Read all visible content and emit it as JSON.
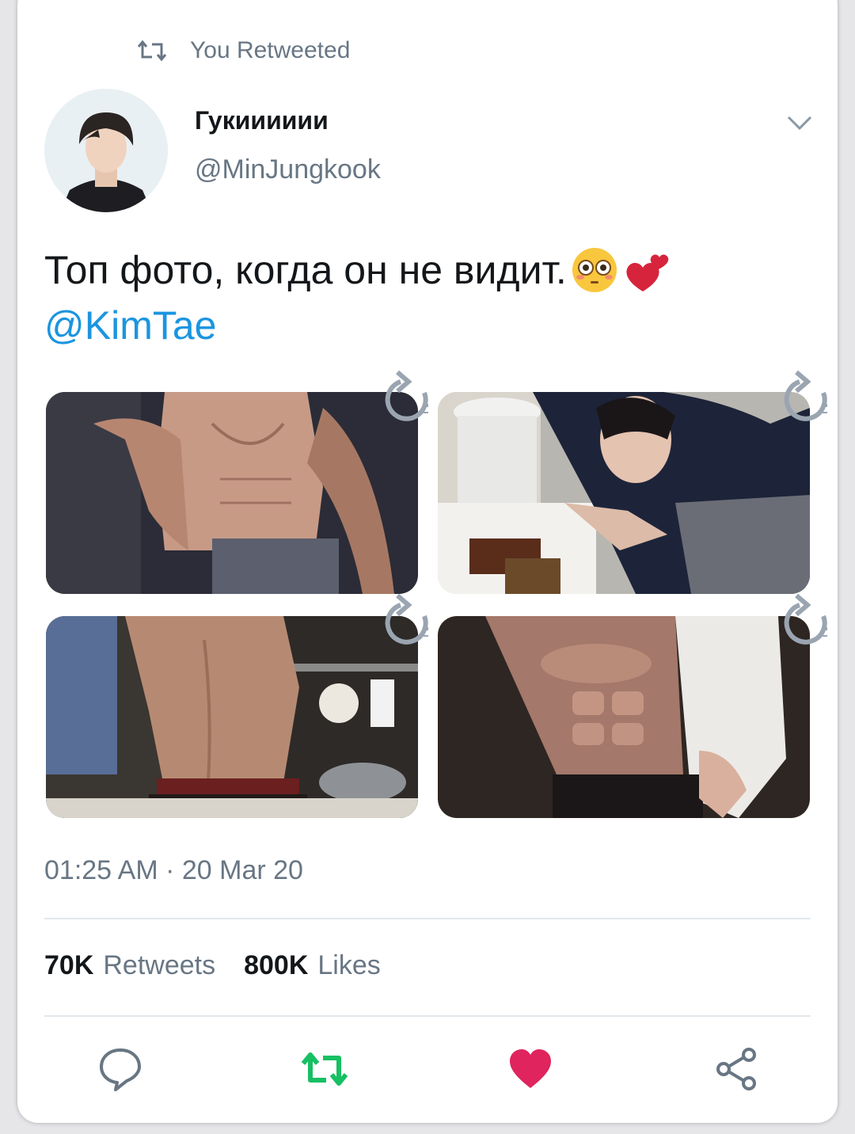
{
  "retweet_context": {
    "label": "You Retweeted"
  },
  "author": {
    "display_name": "Гукииииии",
    "handle": "@MinJungkook"
  },
  "tweet": {
    "text": "Топ фото, когда он не видит.",
    "emojis": [
      "flushed-face",
      "two-hearts"
    ],
    "mention": "@KimTae"
  },
  "media": [
    {
      "name": "photo-1",
      "description_icon": "rotate-icon"
    },
    {
      "name": "photo-2",
      "description_icon": "rotate-icon"
    },
    {
      "name": "photo-3",
      "description_icon": "rotate-icon"
    },
    {
      "name": "photo-4",
      "description_icon": "rotate-icon"
    }
  ],
  "timestamp": "01:25 AM · 20 Mar 20",
  "stats": {
    "retweets": {
      "count": "70K",
      "label": "Retweets"
    },
    "likes": {
      "count": "800K",
      "label": "Likes"
    }
  },
  "actions": [
    "reply-icon",
    "retweet-icon",
    "like-icon",
    "share-icon"
  ],
  "colors": {
    "accent": "#1b95e0",
    "retweet_active": "#17bf63",
    "like_active": "#e0245e",
    "muted": "#687684"
  }
}
